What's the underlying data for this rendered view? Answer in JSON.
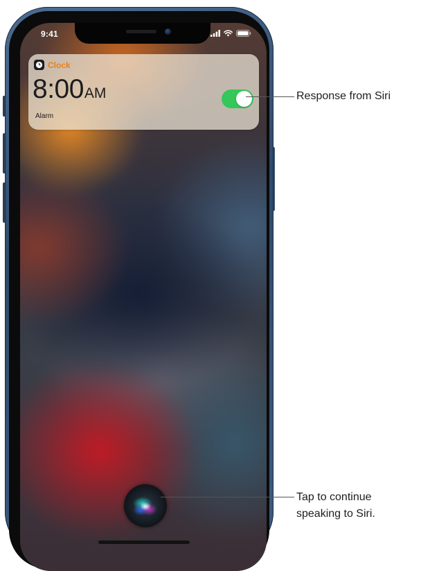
{
  "status_bar": {
    "time": "9:41",
    "icons": [
      "signal-icon",
      "wifi-icon",
      "battery-icon"
    ]
  },
  "notification": {
    "app_name": "Clock",
    "app_icon": "clock-icon",
    "time": "8:00",
    "ampm": "AM",
    "label": "Alarm",
    "toggle_on": true,
    "accent_color": "#e8801c",
    "toggle_color": "#34c759"
  },
  "siri": {
    "icon": "siri-orb-icon"
  },
  "callouts": {
    "response": "Response from Siri",
    "tap_line1": "Tap to continue",
    "tap_line2": "speaking to Siri."
  },
  "colors": {
    "phone_frame": "#3d5c81"
  }
}
